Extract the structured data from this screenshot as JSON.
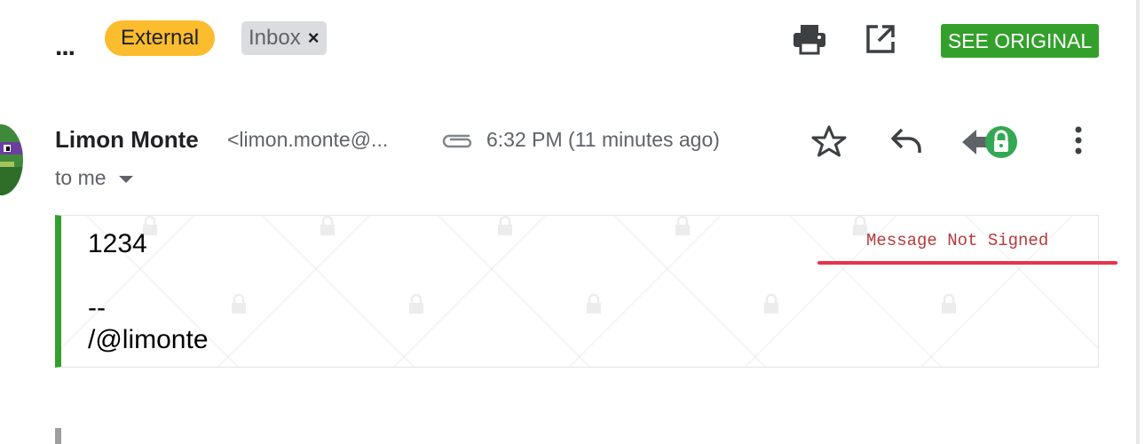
{
  "toolbar": {
    "more_label": "...",
    "labels": [
      {
        "name": "External",
        "color": "#fbbc2d"
      },
      {
        "name": "Inbox",
        "remove": "×"
      }
    ],
    "print_icon": "print-icon",
    "open_new_window_icon": "open-in-new-icon",
    "see_original_label": "SEE ORIGINAL",
    "see_original_color": "#34a02c"
  },
  "message": {
    "sender_name": "Limon Monte",
    "sender_email": "<limon.monte@...",
    "timestamp": "6:32 PM (11 minutes ago)",
    "recipient": "to me",
    "has_attachment": true,
    "actions": [
      "star-icon",
      "reply-icon",
      "forward-lock-icon",
      "more-vert-icon"
    ],
    "body_lines": [
      "1234",
      "",
      "--",
      "/@limonte"
    ],
    "signature_status": "Message Not Signed",
    "signature_status_color": "#b53a3a",
    "accent_color": "#34a02c"
  }
}
